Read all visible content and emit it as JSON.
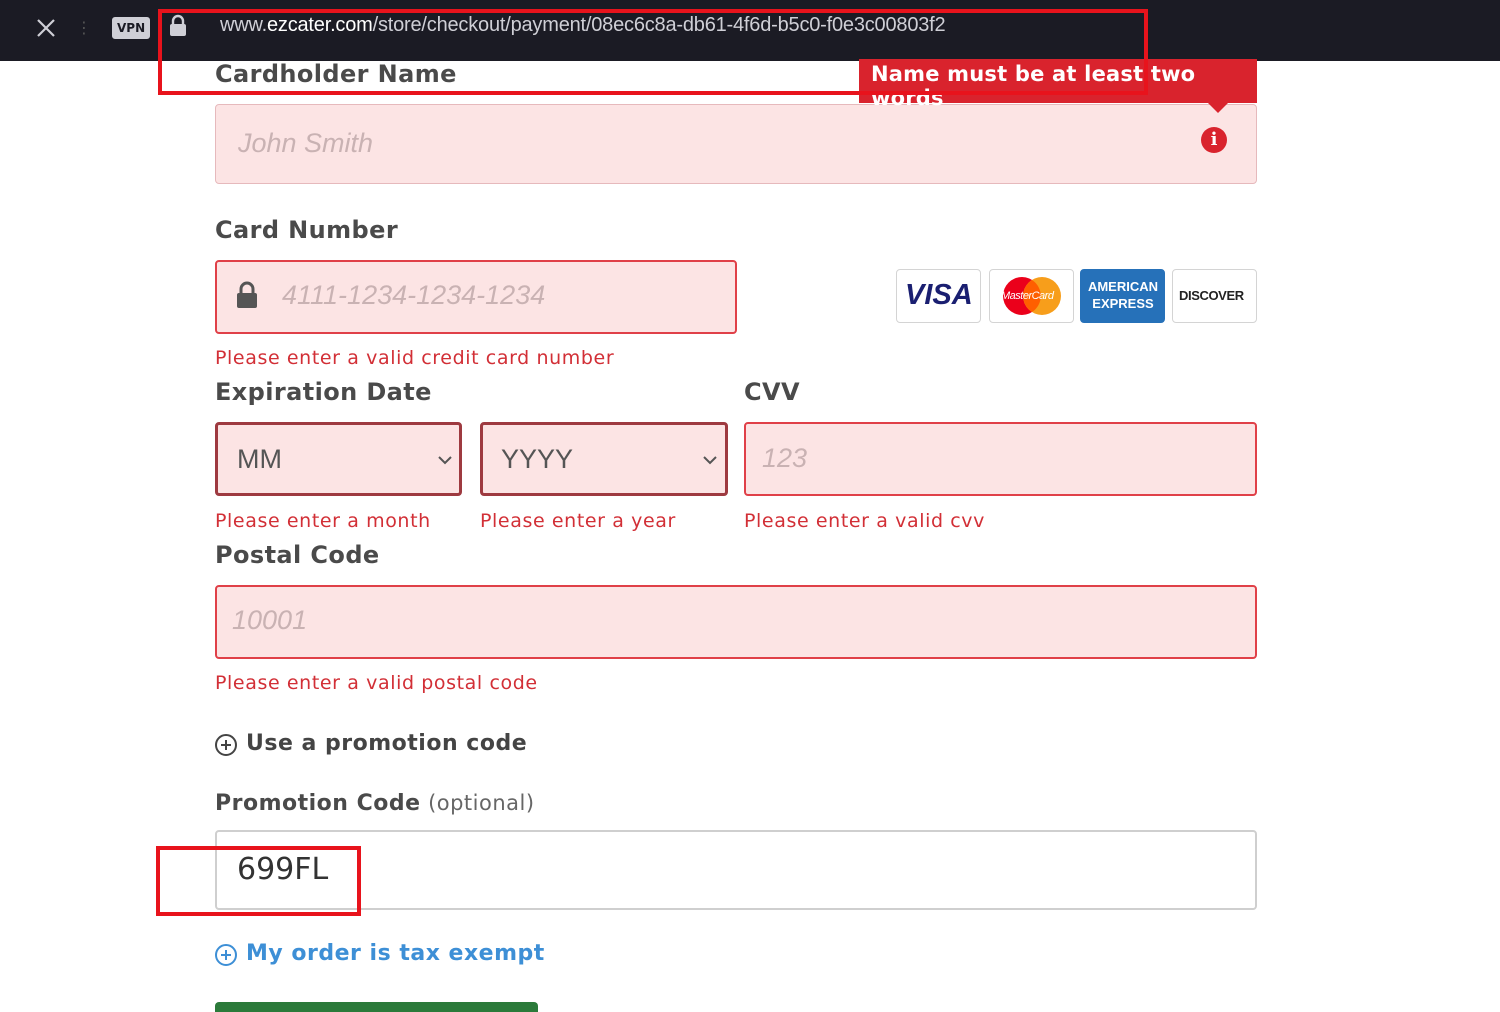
{
  "browser": {
    "vpn_label": "VPN",
    "url_prefix": "www.",
    "url_domain": "ezcater.com",
    "url_path": "/store/checkout/payment/08ec6c8a-db61-4f6d-b5c0-f0e3c00803f2"
  },
  "form": {
    "cardholder": {
      "label": "Cardholder Name",
      "placeholder": "John Smith",
      "tooltip": "Name must be at least two words"
    },
    "card_number": {
      "label": "Card Number",
      "placeholder": "4111-1234-1234-1234",
      "error": "Please enter a valid credit card number",
      "brands": [
        "VISA",
        "MasterCard",
        "AMERICAN EXPRESS",
        "DISCOVER"
      ]
    },
    "expiration": {
      "label": "Expiration Date",
      "month_value": "MM",
      "year_value": "YYYY",
      "month_error": "Please enter a month",
      "year_error": "Please enter a year"
    },
    "cvv": {
      "label": "CVV",
      "placeholder": "123",
      "error": "Please enter a valid cvv"
    },
    "postal": {
      "label": "Postal Code",
      "placeholder": "10001",
      "error": "Please enter a valid postal code"
    },
    "promo_toggle": "Use a promotion code",
    "promo": {
      "label": "Promotion Code",
      "optional": "(optional)",
      "value": "699FL"
    },
    "tax_exempt_toggle": "My order is tax exempt"
  },
  "colors": {
    "error_red": "#d22f36",
    "field_bg": "#fce4e4",
    "link_blue": "#3d8fd6",
    "annotation_red": "#e8131c"
  }
}
